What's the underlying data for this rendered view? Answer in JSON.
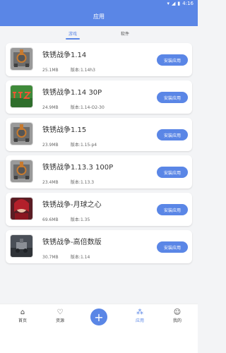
{
  "status": {
    "time": "4:16"
  },
  "header": {
    "title": "应用"
  },
  "tabs": [
    {
      "label": "游戏",
      "active": true
    },
    {
      "label": "软件",
      "active": false
    }
  ],
  "items": [
    {
      "title": "铁锈战争1.14",
      "size": "25.1MB",
      "version": "版本:1.14h3",
      "button": "安装应用",
      "icon": "rusted-warfare-icon"
    },
    {
      "title": "铁锈战争1.14 30P",
      "size": "24.9MB",
      "version": "版本:1.14-O2-30",
      "button": "安装应用",
      "icon": "rts-icon"
    },
    {
      "title": "铁锈战争1.15",
      "size": "23.9MB",
      "version": "版本:1.15-p4",
      "button": "安装应用",
      "icon": "rusted-warfare-icon"
    },
    {
      "title": "铁锈战争1.13.3 100P",
      "size": "23.4MB",
      "version": "版本:1.13.3",
      "button": "安装应用",
      "icon": "rusted-warfare-icon"
    },
    {
      "title": "铁锈战争-月球之心",
      "size": "69.6MB",
      "version": "版本:1.35",
      "button": "安装应用",
      "icon": "moon-heart-icon"
    },
    {
      "title": "铁锈战争-高倍数版",
      "size": "30.7MB",
      "version": "版本:1.14",
      "button": "安装应用",
      "icon": "high-multiplier-icon"
    }
  ],
  "bottom_nav": {
    "home": "首页",
    "resources": "资源",
    "apps": "应用",
    "mine": "我的"
  },
  "colors": {
    "accent": "#5a86e6",
    "background": "#f3f4f6"
  }
}
